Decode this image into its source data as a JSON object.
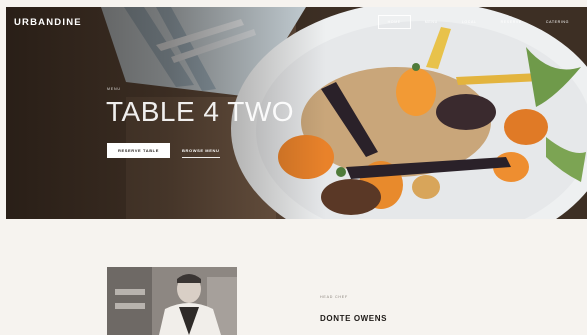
{
  "header": {
    "brand": "URBANDINE",
    "nav": [
      {
        "label": "HOME",
        "active": true
      },
      {
        "label": "MENU",
        "active": false
      },
      {
        "label": "LOCAL",
        "active": false
      },
      {
        "label": "RESERVE",
        "active": false
      },
      {
        "label": "CATERING",
        "active": false
      }
    ]
  },
  "hero": {
    "eyebrow": "MENU",
    "title": "TABLE 4 TWO",
    "primary_button": "RESERVE TABLE",
    "secondary_link": "BROWSE MENU"
  },
  "chef": {
    "eyebrow": "HEAD CHEF",
    "name": "DONTE OWENS"
  },
  "colors": {
    "page_background": "#f6f3ef",
    "text_dark": "#1e1a17",
    "hero_text": "#ffffff"
  }
}
